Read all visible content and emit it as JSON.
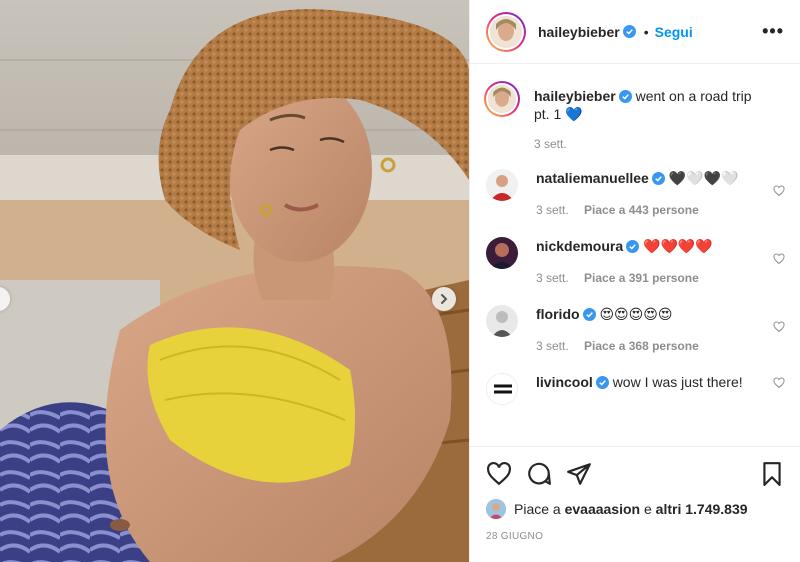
{
  "post": {
    "username": "haileybieber",
    "follow_label": "Segui",
    "more_label": "•••",
    "separator": "•"
  },
  "caption": {
    "username": "haileybieber",
    "text": "went on a road trip pt. 1 💙",
    "time": "3 sett."
  },
  "comments": [
    {
      "username": "nataliemanuellee",
      "text": "🖤🤍🖤🤍",
      "time": "3 sett.",
      "likes": "Piace a 443 persone",
      "avatar_color": "#c62828"
    },
    {
      "username": "nickdemoura",
      "text": "❤️❤️❤️❤️",
      "time": "3 sett.",
      "likes": "Piace a 391 persone",
      "avatar_color": "#7b1f3a"
    },
    {
      "username": "florido",
      "text": "😍😍😍😍😍",
      "time": "3 sett.",
      "likes": "Piace a 368 persone",
      "avatar_color": "#d9d9d9"
    },
    {
      "username": "livincool",
      "text": "wow I was just there!",
      "time": "",
      "likes": "",
      "avatar_color": "#ffffff"
    }
  ],
  "likes_line": {
    "prefix": "Piace a",
    "user": "evaaaasion",
    "middle": "e",
    "others": "altri 1.749.839"
  },
  "date": "28 GIUGNO",
  "icons": {
    "like": "heart-icon",
    "comment": "comment-icon",
    "share": "paper-plane-icon",
    "save": "bookmark-icon",
    "verified": "verified-badge-icon",
    "next": "chevron-right-icon",
    "prev": "chevron-left-icon"
  },
  "colors": {
    "accent": "#0095f6",
    "text": "#262626",
    "muted": "#8e8e8e",
    "border": "#efefef"
  }
}
